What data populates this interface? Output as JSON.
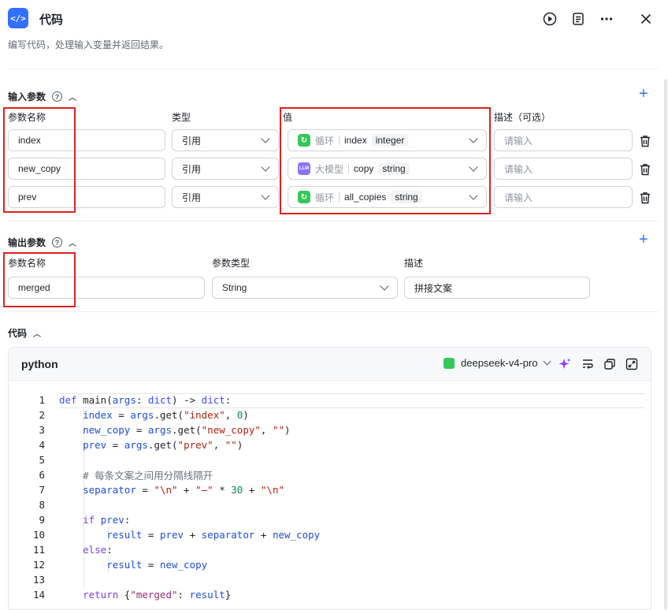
{
  "header": {
    "title": "代码",
    "subtitle": "编写代码，处理输入变量并返回结果。",
    "app_icon_text": "</>",
    "icons": [
      "code-icon",
      "run-icon",
      "doc-icon",
      "more-icon",
      "close-icon"
    ]
  },
  "inputs": {
    "section_title": "输入参数",
    "columns": {
      "name": "参数名称",
      "type": "类型",
      "value": "值",
      "desc": "描述（可选）"
    },
    "rows": [
      {
        "name": "index",
        "type": "引用",
        "source": "循环",
        "source_icon": "loop-icon",
        "var": "index",
        "var_type": "integer",
        "desc_placeholder": "请输入"
      },
      {
        "name": "new_copy",
        "type": "引用",
        "source": "大模型",
        "source_icon": "llm-icon",
        "var": "copy",
        "var_type": "string",
        "desc_placeholder": "请输入"
      },
      {
        "name": "prev",
        "type": "引用",
        "source": "循环",
        "source_icon": "loop-icon",
        "var": "all_copies",
        "var_type": "string",
        "desc_placeholder": "请输入"
      }
    ]
  },
  "outputs": {
    "section_title": "输出参数",
    "columns": {
      "name": "参数名称",
      "type": "参数类型",
      "desc": "描述"
    },
    "rows": [
      {
        "name": "merged",
        "type": "String",
        "desc": "拼接文案"
      }
    ]
  },
  "code": {
    "section_title": "代码",
    "language": "python",
    "model": "deepseek-v4-pro",
    "lines": [
      "def main(args: dict) -> dict:",
      "    index = args.get(\"index\", 0)",
      "    new_copy = args.get(\"new_copy\", \"\")",
      "    prev = args.get(\"prev\", \"\")",
      "",
      "    # 每条文案之间用分隔线隔开",
      "    separator = \"\\n\" + \"—\" * 30 + \"\\n\"",
      "",
      "    if prev:",
      "        result = prev + separator + new_copy",
      "    else:",
      "        result = new_copy",
      "",
      "    return {\"merged\": result}"
    ],
    "line_numbers": [
      "1",
      "2",
      "3",
      "4",
      "5",
      "6",
      "7",
      "8",
      "9",
      "10",
      "11",
      "12",
      "13",
      "14"
    ]
  },
  "colors": {
    "accent": "#3370ff",
    "highlight_box": "#e02020",
    "loop": "#34c759",
    "llm": "#8a73ff"
  }
}
